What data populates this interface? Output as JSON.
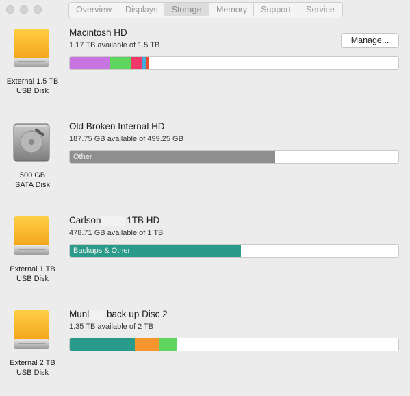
{
  "tabs": [
    {
      "label": "Overview",
      "active": false
    },
    {
      "label": "Displays",
      "active": false
    },
    {
      "label": "Storage",
      "active": true
    },
    {
      "label": "Memory",
      "active": false
    },
    {
      "label": "Support",
      "active": false
    },
    {
      "label": "Service",
      "active": false
    }
  ],
  "drives": [
    {
      "icon": "external-drive-icon",
      "label_line1": "External 1.5 TB",
      "label_line2": "USB Disk",
      "name": "Macintosh HD",
      "available": "1.17 TB available of 1.5 TB",
      "segments": [
        {
          "color": "#c874e0",
          "fraction": 0.12,
          "label": ""
        },
        {
          "color": "#5fd45f",
          "fraction": 0.065,
          "label": ""
        },
        {
          "color": "#f0386b",
          "fraction": 0.035,
          "label": ""
        },
        {
          "color": "#44aadd",
          "fraction": 0.012,
          "label": ""
        },
        {
          "color": "#f04c2e",
          "fraction": 0.01,
          "label": ""
        }
      ],
      "manage_label": "Manage..."
    },
    {
      "icon": "internal-hard-drive-icon",
      "label_line1": "500 GB",
      "label_line2": "SATA Disk",
      "name": "Old Broken Internal HD",
      "available": "187.75 GB available of 499.25 GB",
      "segments": [
        {
          "color": "#8e8e8e",
          "fraction": 0.624,
          "label": "Other"
        }
      ]
    },
    {
      "icon": "external-drive-icon",
      "label_line1": "External 1 TB",
      "label_line2": "USB Disk",
      "name_part1": "Carlson",
      "name_part2": "1TB HD",
      "available": "478.71 GB available of 1 TB",
      "segments": [
        {
          "color": "#2a9a8a",
          "fraction": 0.52,
          "label": "Backups & Other"
        }
      ]
    },
    {
      "icon": "external-drive-icon",
      "label_line1": "External 2 TB",
      "label_line2": "USB Disk",
      "name_part1": "Munl",
      "name_part2": "back up Disc 2",
      "available": "1.35 TB available of 2 TB",
      "segments": [
        {
          "color": "#2a9a8a",
          "fraction": 0.198,
          "label": ""
        },
        {
          "color": "#f7962e",
          "fraction": 0.073,
          "label": ""
        },
        {
          "color": "#5fd45f",
          "fraction": 0.057,
          "label": ""
        }
      ]
    }
  ]
}
